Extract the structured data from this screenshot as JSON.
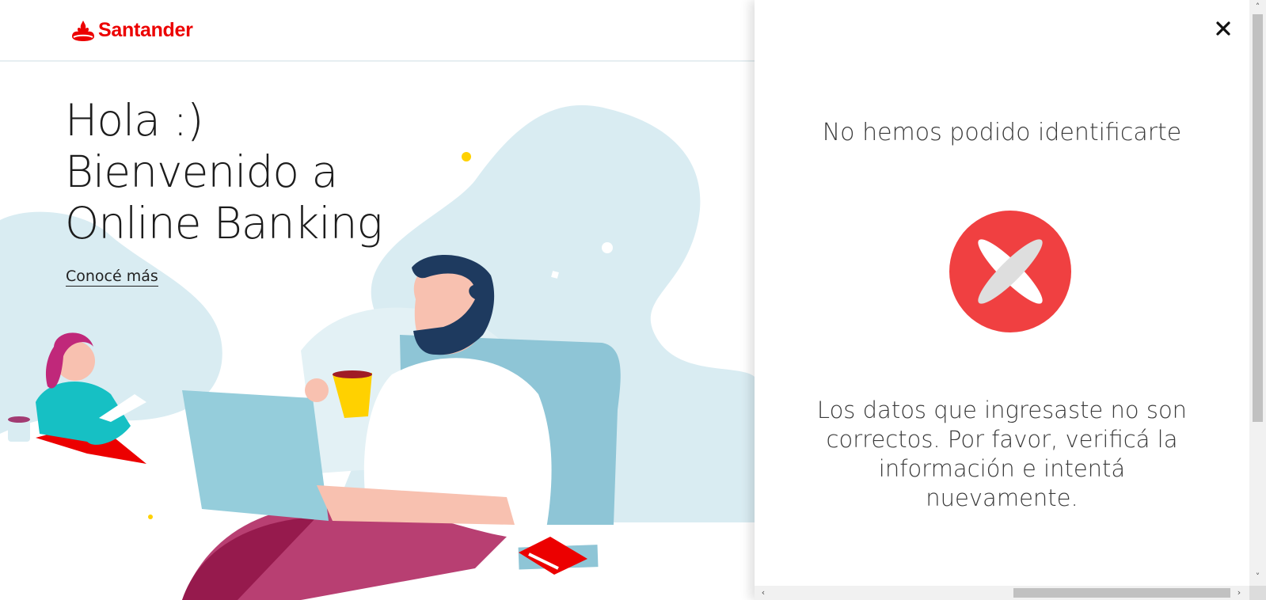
{
  "header": {
    "brand": "Santander",
    "brand_color": "#ec0000"
  },
  "hero": {
    "line1": "Hola :)",
    "line2": "Bienvenido a",
    "line3": "Online Banking",
    "link": "Conocé más"
  },
  "panel": {
    "title": "No hemos podido identificarte",
    "message": "Los datos que ingresaste no son correctos. Por favor, verificá la información e intentá nuevamente.",
    "error_color": "#f04041",
    "close_icon": "close-icon",
    "status_icon": "error-x-icon"
  },
  "scrollbars": {
    "up": "˄",
    "down": "˅",
    "left": "‹",
    "right": "›"
  }
}
